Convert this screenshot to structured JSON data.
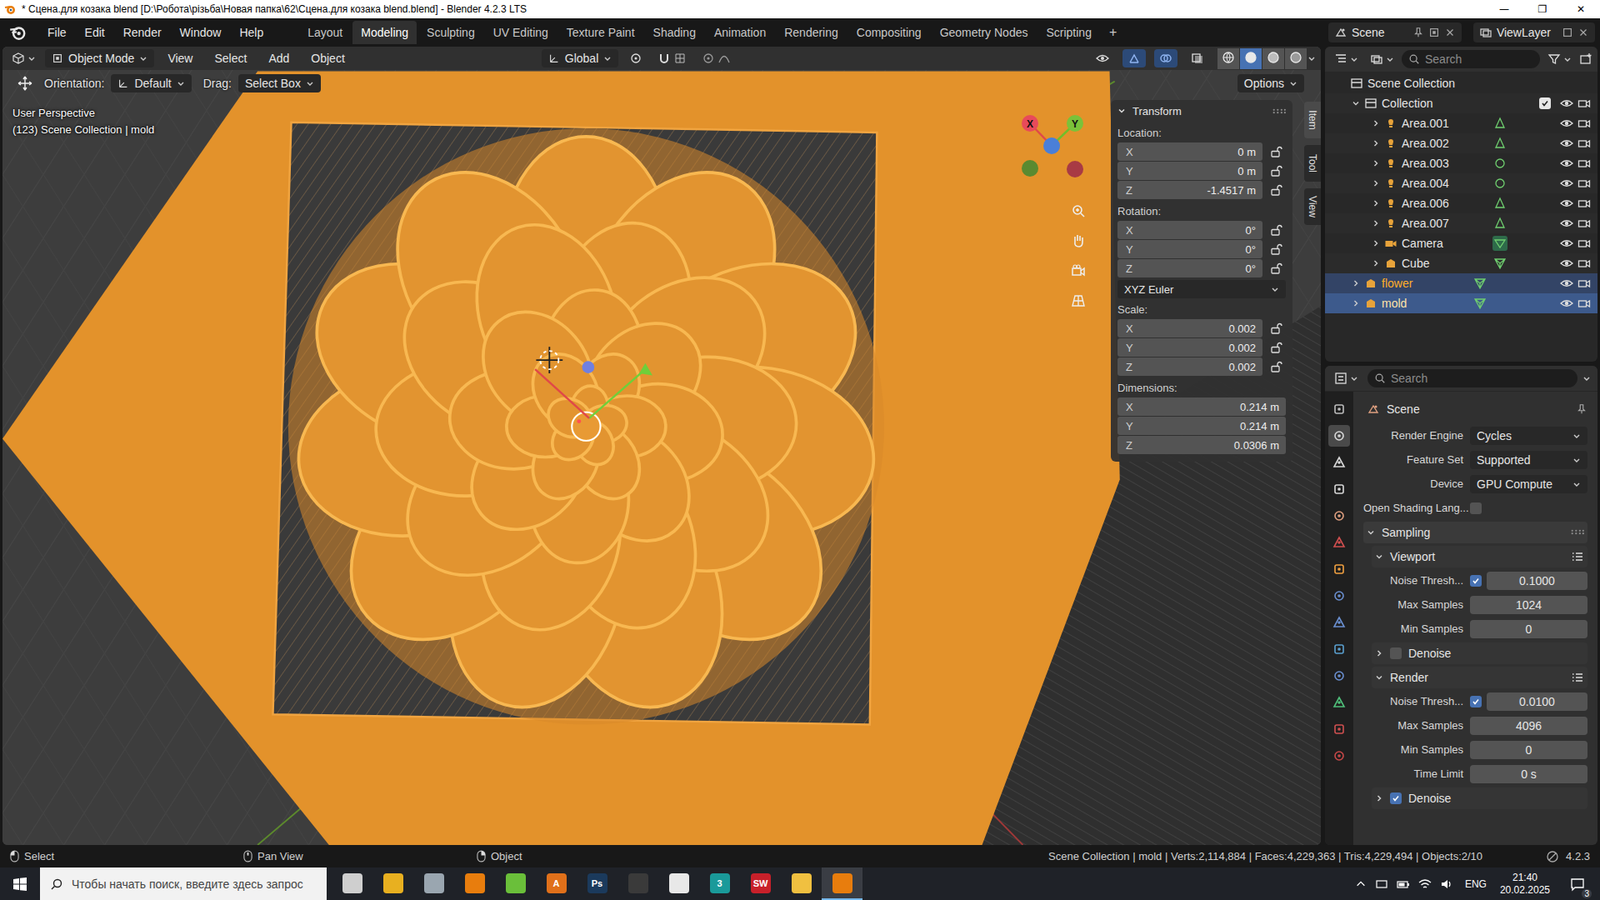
{
  "window": {
    "title": "* Сцена.для козака blend [D:\\Робота\\різьба\\Новая папка\\62\\Сцена.для козака blend.blend] - Blender 4.2.3 LTS",
    "controls": [
      "—",
      "❐",
      "✕"
    ]
  },
  "menu": [
    "File",
    "Edit",
    "Render",
    "Window",
    "Help"
  ],
  "workspaces": [
    {
      "label": "Layout",
      "selected": false
    },
    {
      "label": "Modeling",
      "selected": true
    },
    {
      "label": "Sculpting",
      "selected": false
    },
    {
      "label": "UV Editing",
      "selected": false
    },
    {
      "label": "Texture Paint",
      "selected": false
    },
    {
      "label": "Shading",
      "selected": false
    },
    {
      "label": "Animation",
      "selected": false
    },
    {
      "label": "Rendering",
      "selected": false
    },
    {
      "label": "Compositing",
      "selected": false
    },
    {
      "label": "Geometry Nodes",
      "selected": false
    },
    {
      "label": "Scripting",
      "selected": false
    }
  ],
  "add_workspace": "+",
  "scene": "Scene",
  "view_layer": "ViewLayer",
  "viewport_header": {
    "mode": "Object Mode",
    "menus": [
      "View",
      "Select",
      "Add",
      "Object"
    ],
    "transform": "Global",
    "toggles": [
      {
        "on": false
      },
      {
        "on": true
      },
      {
        "on": true
      },
      {
        "on": false
      }
    ],
    "shading": [
      {
        "selected": false
      },
      {
        "selected": true
      },
      {
        "selected": false
      },
      {
        "selected": false
      }
    ]
  },
  "tool_header": {
    "orientation_label": "Orientation:",
    "orientation": "Default",
    "drag_label": "Drag:",
    "drag": "Select Box",
    "options": "Options"
  },
  "overlay": {
    "view": "User Perspective",
    "info": "(123) Scene Collection | mold"
  },
  "gizmo": {
    "x": "X",
    "y": "Y"
  },
  "side_tabs": [
    {
      "label": "Item",
      "selected": true
    },
    {
      "label": "Tool",
      "selected": false
    },
    {
      "label": "View",
      "selected": false
    }
  ],
  "transform": {
    "title": "Transform",
    "groups": [
      {
        "label": "Location:",
        "lockable": true,
        "mode": "",
        "fields": [
          {
            "axis": "X",
            "value": "0 m"
          },
          {
            "axis": "Y",
            "value": "0 m"
          },
          {
            "axis": "Z",
            "value": "-1.4517 m"
          }
        ]
      },
      {
        "label": "Rotation:",
        "lockable": true,
        "mode": "XYZ Euler",
        "fields": [
          {
            "axis": "X",
            "value": "0°"
          },
          {
            "axis": "Y",
            "value": "0°"
          },
          {
            "axis": "Z",
            "value": "0°"
          }
        ]
      },
      {
        "label": "Scale:",
        "lockable": true,
        "mode": "",
        "fields": [
          {
            "axis": "X",
            "value": "0.002"
          },
          {
            "axis": "Y",
            "value": "0.002"
          },
          {
            "axis": "Z",
            "value": "0.002"
          }
        ]
      },
      {
        "label": "Dimensions:",
        "lockable": false,
        "mode": "",
        "fields": [
          {
            "axis": "X",
            "value": "0.214 m"
          },
          {
            "axis": "Y",
            "value": "0.214 m"
          },
          {
            "axis": "Z",
            "value": "0.0306 m"
          }
        ]
      }
    ]
  },
  "outliner": {
    "search": "Search",
    "root": {
      "name": "Scene Collection",
      "expanded": true
    },
    "collection": {
      "name": "Collection",
      "expanded": true,
      "checked": true,
      "visible": true,
      "renderable": true
    },
    "children": [
      {
        "name": "Area.001",
        "kind": "area",
        "expanded": false,
        "selected": false,
        "active": false,
        "visible": true,
        "renderable": true
      },
      {
        "name": "Area.002",
        "kind": "area",
        "expanded": false,
        "selected": false,
        "active": false,
        "visible": true,
        "renderable": true
      },
      {
        "name": "Area.003",
        "kind": "point",
        "expanded": false,
        "selected": false,
        "active": false,
        "visible": true,
        "renderable": true
      },
      {
        "name": "Area.004",
        "kind": "point",
        "expanded": false,
        "selected": false,
        "active": false,
        "visible": true,
        "renderable": true
      },
      {
        "name": "Area.006",
        "kind": "area",
        "expanded": false,
        "selected": false,
        "active": false,
        "visible": true,
        "renderable": true
      },
      {
        "name": "Area.007",
        "kind": "area",
        "expanded": false,
        "selected": false,
        "active": false,
        "visible": true,
        "renderable": true
      },
      {
        "name": "Camera",
        "kind": "camera",
        "expanded": false,
        "selected": false,
        "active": false,
        "visible": true,
        "renderable": true
      },
      {
        "name": "Cube",
        "kind": "mesh",
        "expanded": false,
        "selected": false,
        "active": false,
        "visible": true,
        "renderable": true
      }
    ],
    "objects": [
      {
        "name": "flower",
        "kind": "mesh",
        "expanded": false,
        "selected": true,
        "active": false,
        "visible": true,
        "renderable": true
      },
      {
        "name": "mold",
        "kind": "mesh",
        "expanded": false,
        "selected": true,
        "active": true,
        "visible": true,
        "renderable": true
      }
    ]
  },
  "properties": {
    "search": "Search",
    "context": "Scene",
    "tabs": [
      {
        "color": "#bdbdbd",
        "selected": false
      },
      {
        "color": "#d8d8d8",
        "selected": true
      },
      {
        "color": "#d8d8d8",
        "selected": false
      },
      {
        "color": "#d8d8d8",
        "selected": false
      },
      {
        "color": "#e0a080",
        "selected": false
      },
      {
        "color": "#d04f4f",
        "selected": false
      },
      {
        "color": "#f0a040",
        "selected": false
      },
      {
        "color": "#6a8fd0",
        "selected": false
      },
      {
        "color": "#6a8fd0",
        "selected": false
      },
      {
        "color": "#5aa0d0",
        "selected": false
      },
      {
        "color": "#6a8fd0",
        "selected": false
      },
      {
        "color": "#4fbf7a",
        "selected": false
      },
      {
        "color": "#d05050",
        "selected": false
      },
      {
        "color": "#c84848",
        "selected": false
      }
    ],
    "rows": [
      {
        "kind": "dropdown",
        "label": "Render Engine",
        "value": "Cycles",
        "checked": false,
        "expanded": false
      },
      {
        "kind": "dropdown",
        "label": "Feature Set",
        "value": "Supported",
        "checked": false,
        "expanded": false
      },
      {
        "kind": "dropdown",
        "label": "Device",
        "value": "GPU Compute",
        "checked": false,
        "expanded": false
      },
      {
        "kind": "checkbox",
        "label": "Open Shading Lang...",
        "value": "",
        "checked": false,
        "expanded": false
      },
      {
        "kind": "panel",
        "label": "Sampling",
        "value": "",
        "checked": false,
        "expanded": true
      },
      {
        "kind": "subpanel",
        "label": "Viewport",
        "value": "",
        "checked": false,
        "expanded": true
      },
      {
        "kind": "checknum",
        "label": "Noise Thresh...",
        "value": "0.1000",
        "checked": true,
        "expanded": false
      },
      {
        "kind": "number",
        "label": "Max Samples",
        "value": "1024",
        "checked": false,
        "expanded": false
      },
      {
        "kind": "number",
        "label": "Min Samples",
        "value": "0",
        "checked": false,
        "expanded": false
      },
      {
        "kind": "checkpanel",
        "label": "Denoise",
        "value": "",
        "checked": false,
        "expanded": false
      },
      {
        "kind": "subpanel",
        "label": "Render",
        "value": "",
        "checked": false,
        "expanded": true
      },
      {
        "kind": "checknum",
        "label": "Noise Thresh...",
        "value": "0.0100",
        "checked": true,
        "expanded": false
      },
      {
        "kind": "number",
        "label": "Max Samples",
        "value": "4096",
        "checked": false,
        "expanded": false
      },
      {
        "kind": "number",
        "label": "Min Samples",
        "value": "0",
        "checked": false,
        "expanded": false
      },
      {
        "kind": "number",
        "label": "Time Limit",
        "value": "0 s",
        "checked": false,
        "expanded": false
      },
      {
        "kind": "checkpanel",
        "label": "Denoise",
        "value": "",
        "checked": true,
        "expanded": false
      }
    ]
  },
  "status_bar": {
    "hints": [
      "Select",
      "Pan View",
      "Object"
    ],
    "stats": "Scene Collection | mold | Verts:2,114,884 | Faces:4,229,363 | Tris:4,229,494 | Objects:2/10",
    "version": "4.2.3"
  },
  "taskbar": {
    "search": "Чтобы начать поиск, введите здесь запрос",
    "apps": [
      {
        "label": "",
        "color": "#cfcfcf",
        "active": false
      },
      {
        "label": "",
        "color": "#e8b020",
        "active": false
      },
      {
        "label": "",
        "color": "#9aa6b0",
        "active": false
      },
      {
        "label": "",
        "color": "#e87d0d",
        "active": false
      },
      {
        "label": "",
        "color": "#6abf3a",
        "active": false
      },
      {
        "label": "A",
        "color": "#e0701a",
        "active": false
      },
      {
        "label": "Ps",
        "color": "#1b3a5c",
        "active": false
      },
      {
        "label": "",
        "color": "#3a3a3a",
        "active": false
      },
      {
        "label": "",
        "color": "#e8e8e8",
        "active": false
      },
      {
        "label": "3",
        "color": "#1a9a9a",
        "active": false
      },
      {
        "label": "SW",
        "color": "#c8202a",
        "active": false
      },
      {
        "label": "",
        "color": "#f0c040",
        "active": false
      },
      {
        "label": "",
        "color": "#e87d0d",
        "active": true
      }
    ],
    "lang": "ENG",
    "time": "21:40",
    "date": "20.02.2025",
    "notifications": "3"
  }
}
